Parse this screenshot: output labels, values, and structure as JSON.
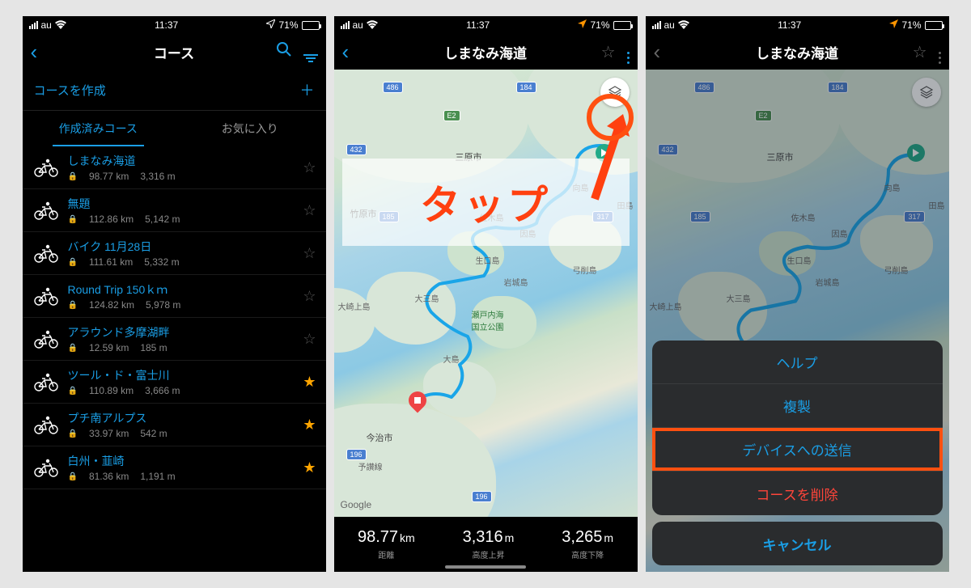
{
  "status": {
    "carrier": "au",
    "time": "11:37",
    "battery": "71%"
  },
  "screen1": {
    "title": "コース",
    "create_label": "コースを作成",
    "tabs": {
      "created": "作成済みコース",
      "favorites": "お気に入り"
    },
    "courses": [
      {
        "name": "しまなみ海道",
        "distance": "98.77 km",
        "elev": "3,316 m",
        "fav": false
      },
      {
        "name": "無題",
        "distance": "112.86 km",
        "elev": "5,142 m",
        "fav": false
      },
      {
        "name": "バイク 11月28日",
        "distance": "111.61 km",
        "elev": "5,332 m",
        "fav": false
      },
      {
        "name": "Round Trip 150ｋｍ",
        "distance": "124.82 km",
        "elev": "5,978 m",
        "fav": false
      },
      {
        "name": "アラウンド多摩湖畔",
        "distance": "12.59 km",
        "elev": "185 m",
        "fav": false
      },
      {
        "name": "ツール・ド・富士川",
        "distance": "110.89 km",
        "elev": "3,666 m",
        "fav": true
      },
      {
        "name": "プチ南アルプス",
        "distance": "33.97 km",
        "elev": "542 m",
        "fav": true
      },
      {
        "name": "白州・韮崎",
        "distance": "81.36 km",
        "elev": "1,191 m",
        "fav": true
      }
    ]
  },
  "screen2": {
    "title": "しまなみ海道",
    "annotation": "タップ",
    "map": {
      "attribution": "Google",
      "shields": [
        "486",
        "184",
        "E2",
        "432",
        "185",
        "317",
        "196",
        "196"
      ],
      "labels": {
        "mihara": "三原市",
        "mukaishima": "向島",
        "takehara": "竹原市",
        "sagishima": "佐木島",
        "innoshima": "因島",
        "tajima": "田島",
        "ikuchi": "生口島",
        "yuge": "弓削島",
        "iwagi": "岩城島",
        "omishima": "大三島",
        "okamijima": "大崎上島",
        "park": "瀬戸内海\n国立公園",
        "oshima": "大島",
        "imabari": "今治市",
        "yosan": "予讃線"
      }
    },
    "stats": {
      "distance": {
        "value": "98.77",
        "unit": "km",
        "label": "距離"
      },
      "ascent": {
        "value": "3,316",
        "unit": "m",
        "label": "高度上昇"
      },
      "descent": {
        "value": "3,265",
        "unit": "m",
        "label": "高度下降"
      }
    }
  },
  "screen3": {
    "title": "しまなみ海道",
    "sheet": {
      "help": "ヘルプ",
      "duplicate": "複製",
      "send": "デバイスへの送信",
      "delete": "コースを削除",
      "cancel": "キャンセル"
    }
  }
}
